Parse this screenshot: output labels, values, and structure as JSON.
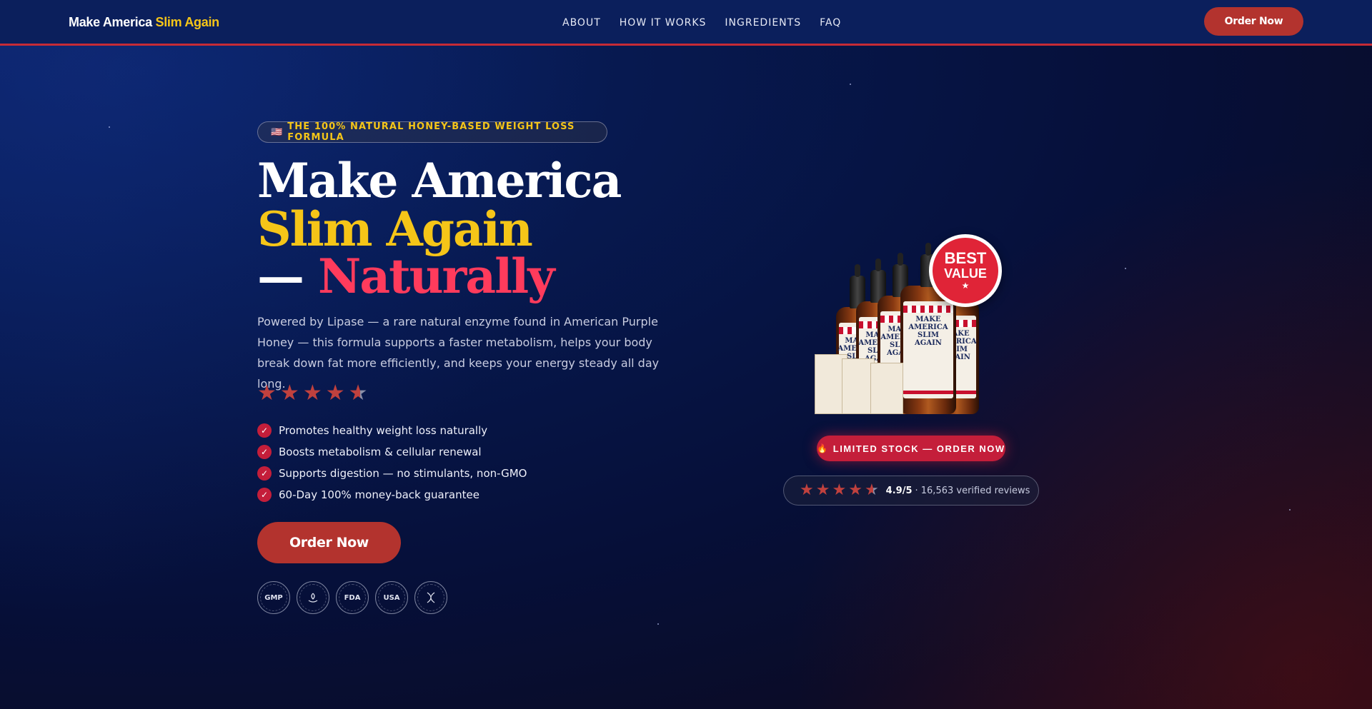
{
  "brand": {
    "part1": "Make America",
    "part2": "Slim Again"
  },
  "nav": {
    "items": [
      "ABOUT",
      "HOW IT WORKS",
      "INGREDIENTS",
      "FAQ"
    ],
    "order_button": "Order Now"
  },
  "hero": {
    "pill_icon": "🇺🇸",
    "pill_text": "THE 100% NATURAL HONEY-BASED WEIGHT LOSS FORMULA",
    "headline_line1": "Make America",
    "headline_line2": "Slim Again",
    "headline_dash": "— ",
    "headline_line3": "Naturally",
    "description": "Powered by Lipase — a rare natural enzyme found in American Purple Honey — this formula supports a faster metabolism, helps your body break down fat more efficiently, and keeps your energy steady all day long.",
    "rating_stars": 4.5,
    "bullets": [
      "Promotes healthy weight loss naturally",
      "Boosts metabolism & cellular renewal",
      "Supports digestion — no stimulants, non-GMO",
      "60-Day 100% money-back guarantee"
    ],
    "cta_label": "Order Now",
    "badges": [
      "GMP",
      "",
      "FDA",
      "USA",
      ""
    ]
  },
  "product": {
    "bottle_label": "MAKE AMERICA SLIM AGAIN",
    "best_value_line1": "BEST",
    "best_value_line2": "VALUE",
    "best_value_star": "★",
    "stock_icon": "🔥",
    "stock_text": "LIMITED STOCK — ORDER NOW",
    "review_score": "4.9/5",
    "review_count": "· 16,563 verified reviews"
  },
  "colors": {
    "accent_yellow": "#f5c518",
    "accent_red": "#c41e3a",
    "headline_red": "#ff3b5c",
    "button_red": "#b3332e",
    "nav_bg": "#0b1f5c"
  },
  "icons": {
    "check": "check-icon",
    "star": "star-icon",
    "flag": "us-flag-icon",
    "fire": "fire-icon"
  }
}
